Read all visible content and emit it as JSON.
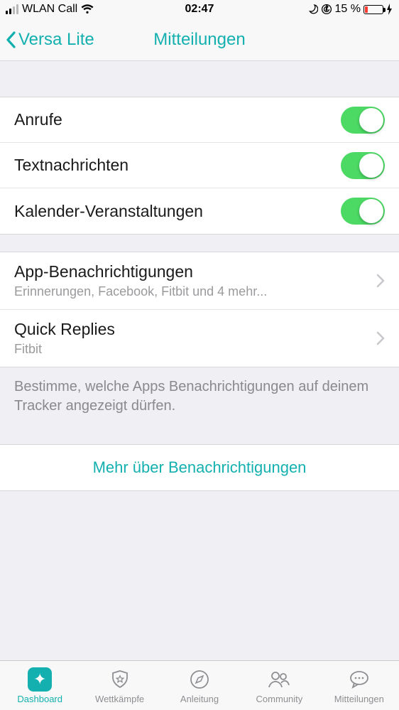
{
  "status": {
    "carrier": "WLAN Call",
    "time": "02:47",
    "battery_pct": "15 %"
  },
  "nav": {
    "back_label": "Versa Lite",
    "title": "Mitteilungen"
  },
  "toggles": {
    "calls": "Anrufe",
    "texts": "Textnachrichten",
    "calendar": "Kalender-Veranstaltungen"
  },
  "rows": {
    "app_notifs": {
      "title": "App-Benachrichtigungen",
      "sub": "Erinnerungen, Facebook, Fitbit und 4 mehr..."
    },
    "quick_replies": {
      "title": "Quick Replies",
      "sub": "Fitbit"
    }
  },
  "footer_note": "Bestimme, welche Apps Benachrichtigungen auf deinem Tracker angezeigt dürfen.",
  "more_link": "Mehr über Benachrichtigungen",
  "tabs": {
    "dashboard": "Dashboard",
    "challenges": "Wettkämpfe",
    "guidance": "Anleitung",
    "community": "Community",
    "notifications": "Mitteilungen"
  }
}
